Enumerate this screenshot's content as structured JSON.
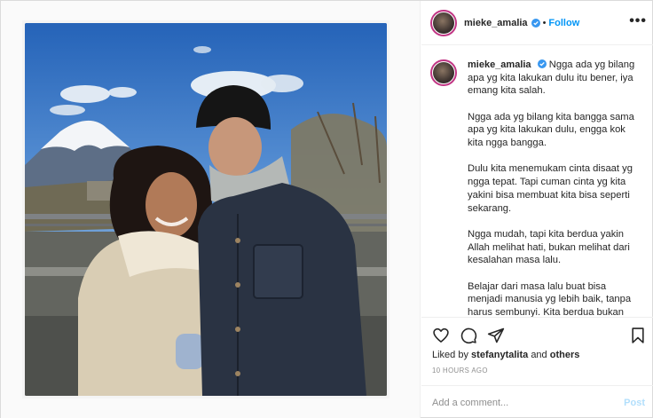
{
  "header": {
    "username": "mieke_amalia",
    "separator": "•",
    "follow_label": "Follow",
    "more_label": "•••",
    "verified_icon": "verified-badge-icon",
    "accent_color": "#0095f6"
  },
  "caption": {
    "username": "mieke_amalia",
    "paragraphs": [
      "Ngga ada yg bilang apa yg kita lakukan dulu itu bener, iya emang kita salah.",
      "Ngga ada yg bilang kita bangga sama apa yg kita lakukan dulu, engga kok kita ngga bangga.",
      "Dulu kita menemukam cinta disaat yg ngga tepat. Tapi cuman cinta yg kita yakini bisa membuat kita bisa seperti sekarang.",
      "Ngga mudah, tapi kita berdua yakin Allah melihat hati, bukan melihat dari kesalahan masa lalu.",
      "Belajar dari masa lalu buat bisa menjadi manusia yg lebih baik, tanpa harus sembunyi. Kita berdua bukan"
    ]
  },
  "actions": {
    "icons": [
      "heart-icon",
      "comment-icon",
      "share-icon",
      "bookmark-icon"
    ],
    "likes_prefix": "Liked by",
    "likes_user": "stefanytalita",
    "likes_and": "and",
    "likes_suffix": "others",
    "timestamp": "10 HOURS AGO"
  },
  "comment": {
    "placeholder": "Add a comment...",
    "post_label": "Post"
  }
}
